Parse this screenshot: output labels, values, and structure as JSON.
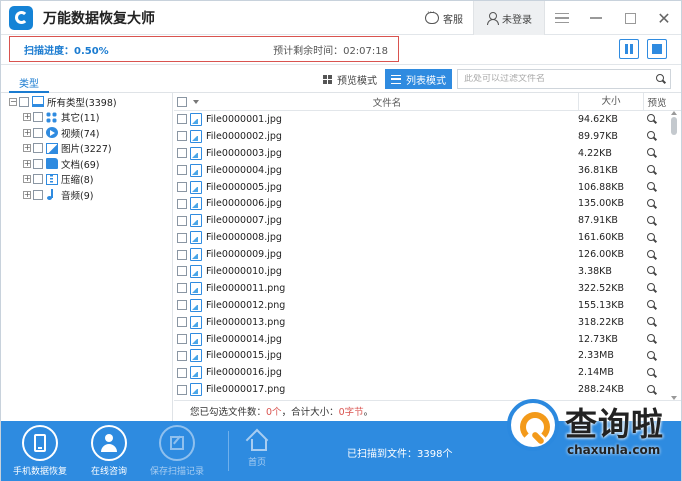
{
  "app": {
    "title": "万能数据恢复大师"
  },
  "titlebar": {
    "service_label": "客服",
    "login_label": "未登录"
  },
  "progress": {
    "label": "扫描进度：0.50%",
    "value_percent": 0.5,
    "remaining": "预计剩余时间：02:07:18"
  },
  "toolbar": {
    "tab_type": "类型",
    "preview_mode": "预览模式",
    "list_mode": "列表模式",
    "search_placeholder": "此处可以过滤文件名"
  },
  "tree": {
    "root": "所有类型(3398)",
    "items": [
      {
        "label": "其它(11)",
        "icon": "apps-icon"
      },
      {
        "label": "视频(74)",
        "icon": "video-icon"
      },
      {
        "label": "图片(3227)",
        "icon": "image-icon"
      },
      {
        "label": "文档(69)",
        "icon": "folder-icon"
      },
      {
        "label": "压缩(8)",
        "icon": "zip-icon"
      },
      {
        "label": "音频(9)",
        "icon": "music-icon"
      }
    ]
  },
  "list": {
    "columns": {
      "name": "文件名",
      "size": "大小",
      "preview": "预览"
    },
    "rows": [
      {
        "name": "File0000001.jpg",
        "size": "94.62KB"
      },
      {
        "name": "File0000002.jpg",
        "size": "89.97KB"
      },
      {
        "name": "File0000003.jpg",
        "size": "4.22KB"
      },
      {
        "name": "File0000004.jpg",
        "size": "36.81KB"
      },
      {
        "name": "File0000005.jpg",
        "size": "106.88KB"
      },
      {
        "name": "File0000006.jpg",
        "size": "135.00KB"
      },
      {
        "name": "File0000007.jpg",
        "size": "87.91KB"
      },
      {
        "name": "File0000008.jpg",
        "size": "161.60KB"
      },
      {
        "name": "File0000009.jpg",
        "size": "126.00KB"
      },
      {
        "name": "File0000010.jpg",
        "size": "3.38KB"
      },
      {
        "name": "File0000011.png",
        "size": "322.52KB"
      },
      {
        "name": "File0000012.png",
        "size": "155.13KB"
      },
      {
        "name": "File0000013.png",
        "size": "318.22KB"
      },
      {
        "name": "File0000014.jpg",
        "size": "12.73KB"
      },
      {
        "name": "File0000015.jpg",
        "size": "2.33MB"
      },
      {
        "name": "File0000016.jpg",
        "size": "2.14MB"
      },
      {
        "name": "File0000017.png",
        "size": "288.24KB"
      }
    ]
  },
  "summary": {
    "prefix": "您已勾选文件数：",
    "count": "0个",
    "middle": "，合计大小：",
    "total": "0字节",
    "suffix": "。"
  },
  "bottom": {
    "phone_recovery": "手机数据恢复",
    "online_consult": "在线咨询",
    "save_scan_record": "保存扫描记录",
    "home": "首页",
    "scanned": "已扫描到文件：3398个"
  },
  "watermark": {
    "title": "查询啦",
    "url": "chaxunla.com"
  },
  "colors": {
    "accent": "#2e8be0",
    "highlight_red": "#d9534f"
  }
}
